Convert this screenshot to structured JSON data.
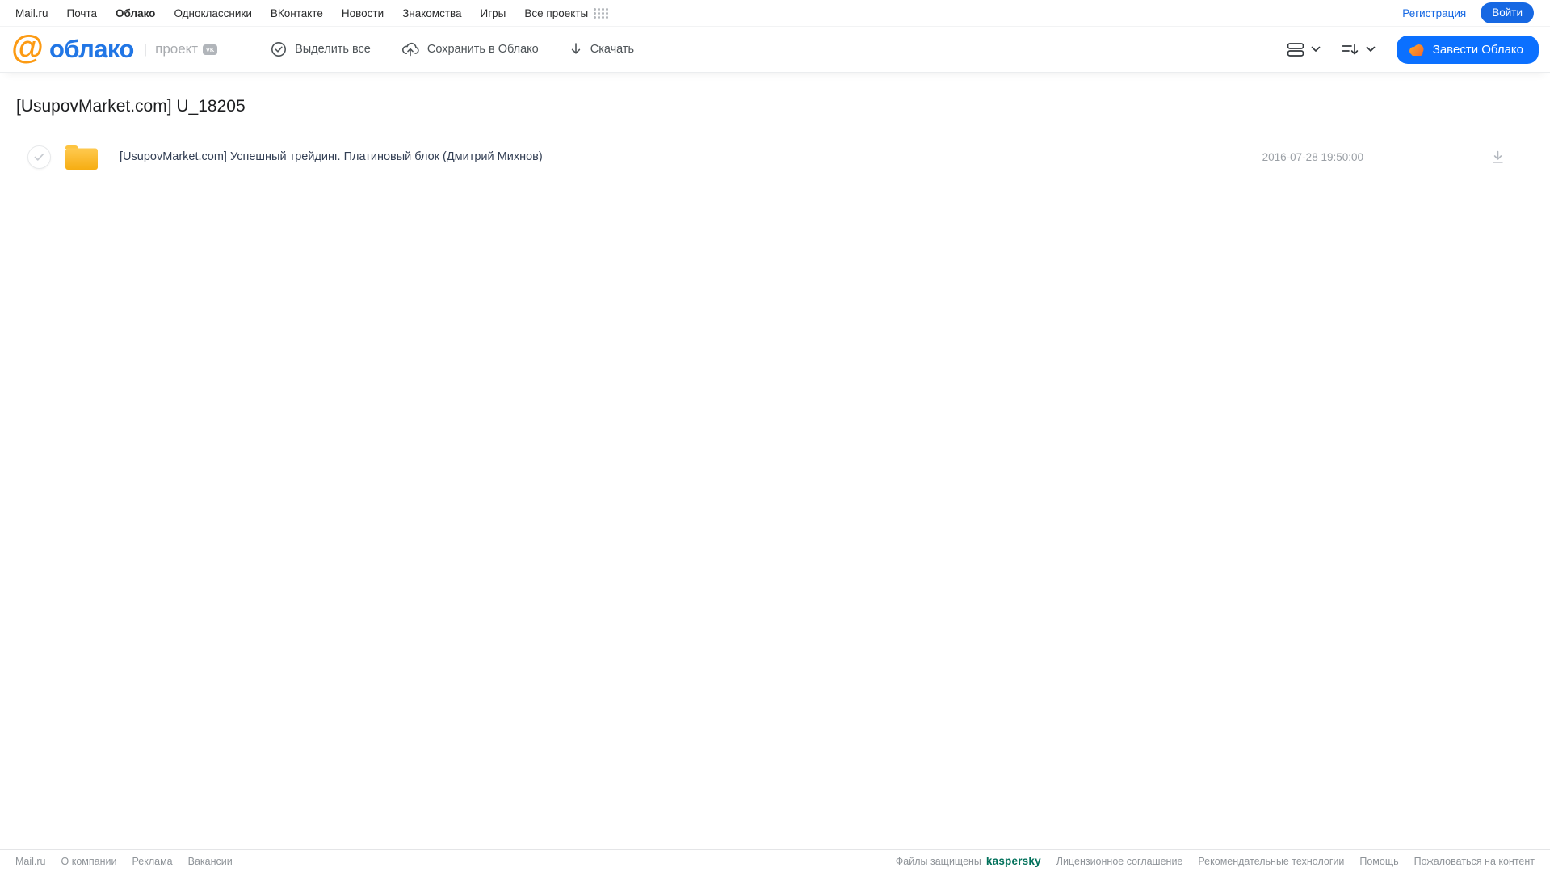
{
  "topnav": {
    "links": [
      "Mail.ru",
      "Почта",
      "Облако",
      "Одноклассники",
      "ВКонтакте",
      "Новости",
      "Знакомства",
      "Игры",
      "Все проекты"
    ],
    "active_link": "Облако",
    "registration": "Регистрация",
    "login": "Войти"
  },
  "header": {
    "logo": {
      "at": "@",
      "word": "облако",
      "divider": "|",
      "project": "проект",
      "vk": "VK"
    },
    "toolbar": [
      {
        "label": "Выделить все",
        "icon": "check-circle-icon"
      },
      {
        "label": "Сохранить в Облако",
        "icon": "cloud-upload-icon"
      },
      {
        "label": "Скачать",
        "icon": "download-arrow-icon"
      }
    ],
    "create_button": "Завести Облако"
  },
  "main": {
    "title": "[UsupovMarket.com] U_18205",
    "files": [
      {
        "type": "folder",
        "name": "[UsupovMarket.com] Успешный трейдинг. Платиновый блок (Дмитрий Михнов)",
        "date": "2016-07-28 19:50:00"
      }
    ]
  },
  "footer": {
    "left_links": [
      "Mail.ru",
      "О компании",
      "Реклама",
      "Вакансии"
    ],
    "protected_label": "Файлы защищены",
    "kaspersky": "kaspersky",
    "right_links": [
      "Лицензионное соглашение",
      "Рекомендательные технологии",
      "Помощь",
      "Пожаловаться на контент"
    ]
  },
  "colors": {
    "accent_blue": "#0b70ff",
    "link_blue": "#1668e3",
    "logo_blue": "#2176e5",
    "logo_orange": "#fc9a12",
    "folder_yellow_top": "#ffcc55",
    "folder_yellow_bottom": "#f6ac10",
    "kaspersky_green": "#00705a"
  }
}
